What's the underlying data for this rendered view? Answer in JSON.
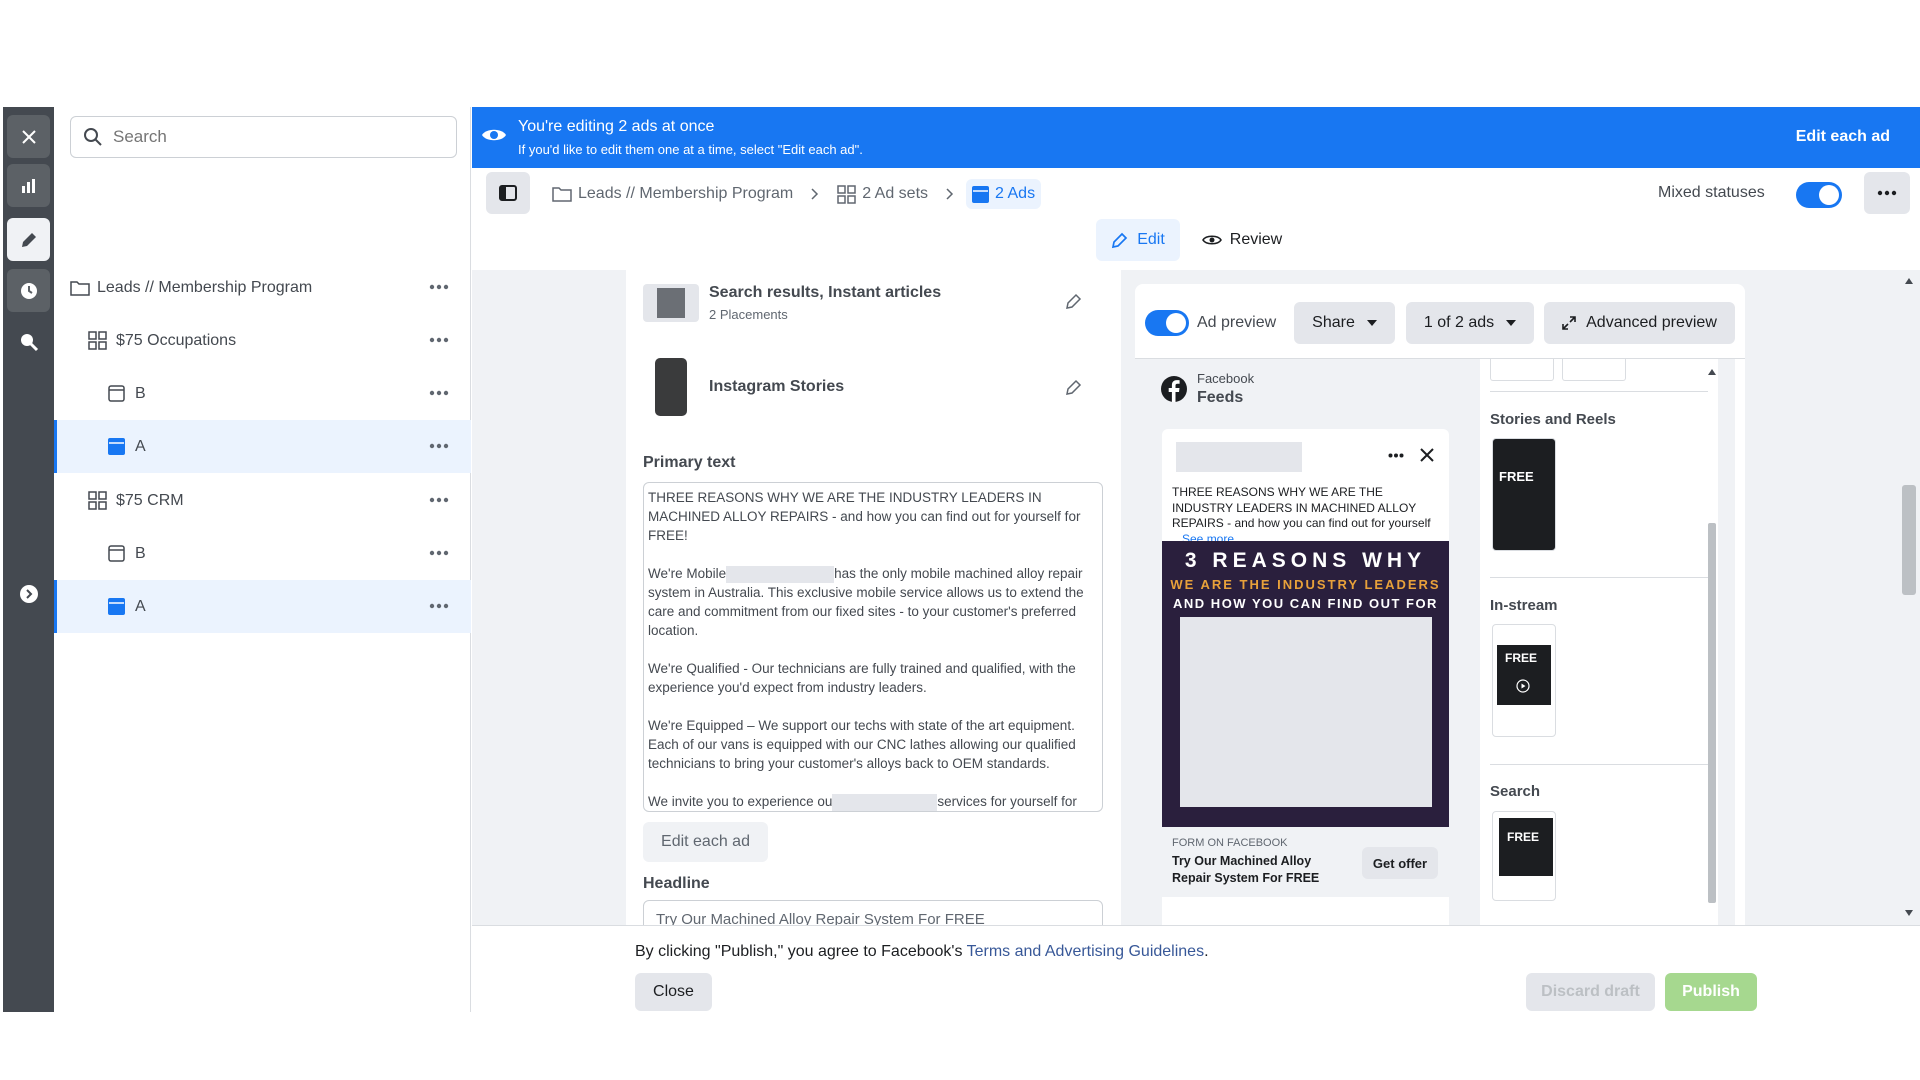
{
  "banner": {
    "title": "You're editing 2 ads at once",
    "subtitle": "If you'd like to edit them one at a time, select \"Edit each ad\".",
    "action": "Edit each ad"
  },
  "search": {
    "placeholder": "Search"
  },
  "tree": {
    "campaign": "Leads // Membership Program",
    "adset1": "$75 Occupations",
    "adset1_ads": [
      "B",
      "A"
    ],
    "adset2": "$75 CRM",
    "adset2_ads": [
      "B",
      "A"
    ]
  },
  "toolbar": {
    "crumb_campaign": "Leads // Membership Program",
    "crumb_adsets": "2 Ad sets",
    "crumb_ads": "2 Ads",
    "status_label": "Mixed statuses"
  },
  "tabs": {
    "edit": "Edit",
    "review": "Review"
  },
  "placements": [
    {
      "title": "Search results, Instant articles",
      "sub": "2 Placements"
    },
    {
      "title": "Instagram Stories",
      "sub": ""
    }
  ],
  "primary_text": {
    "label": "Primary text",
    "p1": "THREE REASONS WHY WE ARE THE INDUSTRY LEADERS IN MACHINED ALLOY REPAIRS  - and how you can find out for yourself for FREE!",
    "p2a": "We're Mobile",
    "p2b": "has the only mobile machined alloy repair system in Australia. This exclusive mobile service allows us to extend the care and commitment from our fixed sites - to your customer's preferred location.",
    "p3": "We're Qualified - Our technicians are fully trained and qualified, with the experience you'd expect from industry leaders.",
    "p4": "We're Equipped – We support our techs with state of the art equipment. Each of our vans is equipped with our CNC lathes allowing our qualified technicians to bring your customer's alloys back to OEM standards.",
    "p5a": "We invite you to experience ou",
    "p5b": "services for yourself for FREE - Simply fill out the form below and we'll organise the rest!",
    "edit_each": "Edit each ad"
  },
  "headline": {
    "label": "Headline",
    "value": "Try Our Machined Alloy Repair System For FREE"
  },
  "preview": {
    "toggle_label": "Ad preview",
    "share": "Share",
    "ads_count": "1 of 2 ads",
    "advanced": "Advanced preview",
    "platform": "Facebook",
    "placement": "Feeds",
    "post_text": "THREE REASONS WHY WE ARE THE INDUSTRY LEADERS IN MACHINED ALLOY REPAIRS - and how you can find out for yourself",
    "see_more": "...See more",
    "img_line1": "3 REASONS WHY",
    "img_line2": "WE ARE THE INDUSTRY LEADERS",
    "img_line3": "AND HOW YOU CAN FIND OUT FOR",
    "cta_source": "FORM ON FACEBOOK",
    "cta_title": "Try Our Machined Alloy Repair System For FREE",
    "cta_button": "Get offer",
    "sections": [
      "Stories and Reels",
      "In-stream",
      "Search"
    ],
    "thumb_text": "FREE"
  },
  "footer": {
    "text": "By clicking \"Publish,\" you agree to Facebook's ",
    "link": "Terms and Advertising Guidelines",
    "after": ".",
    "close": "Close",
    "discard": "Discard draft",
    "publish": "Publish"
  },
  "colors": {
    "accent": "#1877f2",
    "rail": "#444950",
    "selected_bg": "#ebf3fe",
    "publish_disabled": "#a6d88f"
  }
}
